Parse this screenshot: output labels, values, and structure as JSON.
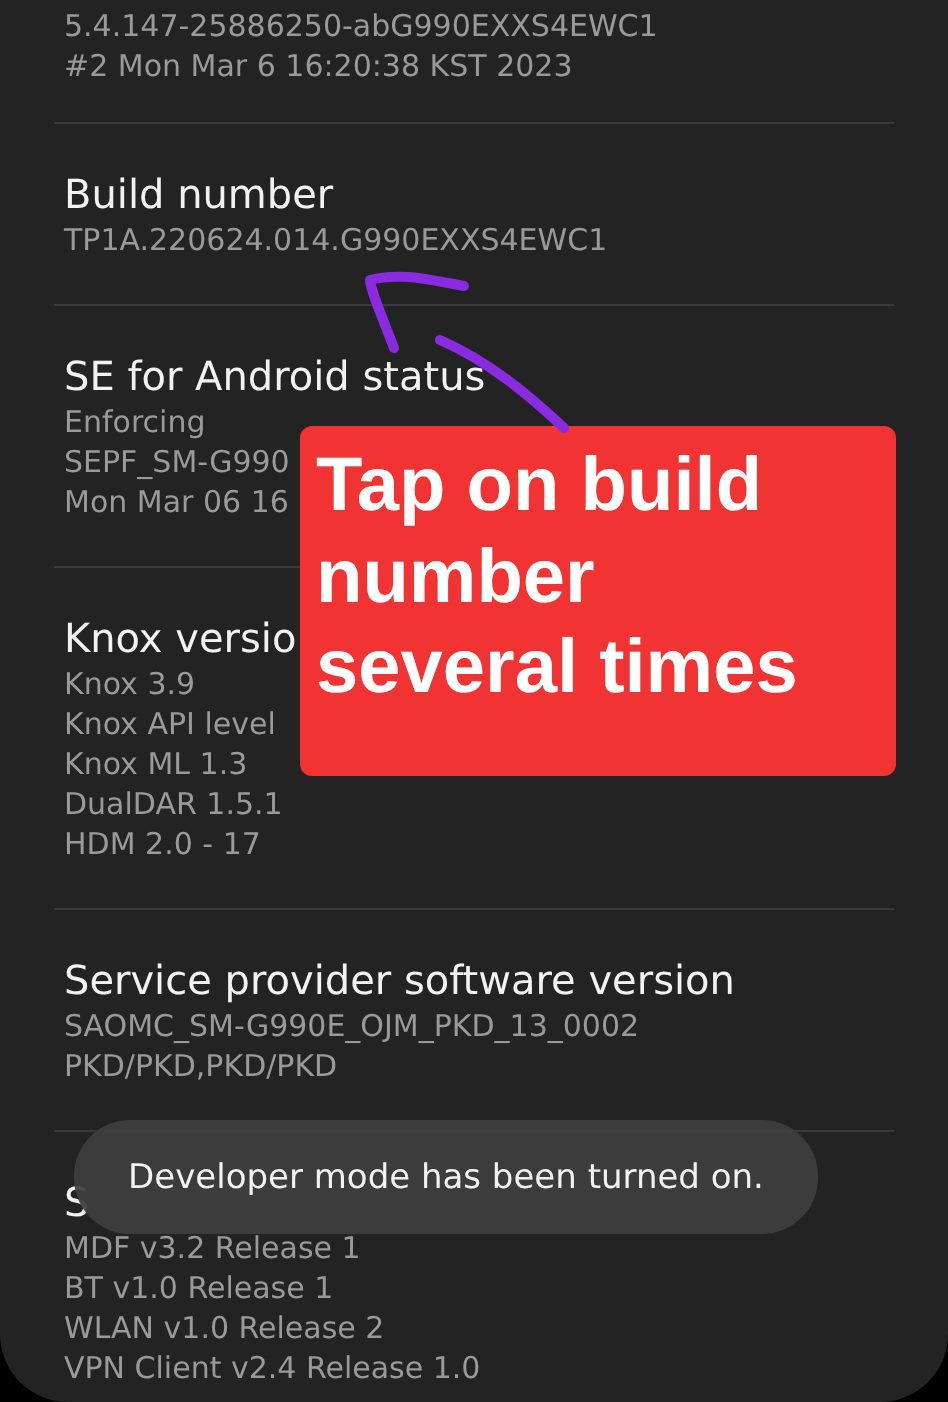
{
  "sections": [
    {
      "lines": [
        "5.4.147-25886250-abG990EXXS4EWC1",
        "#2 Mon Mar 6 16:20:38 KST 2023"
      ]
    },
    {
      "title": "Build number",
      "lines": [
        "TP1A.220624.014.G990EXXS4EWC1"
      ]
    },
    {
      "title": "SE for Android status",
      "lines": [
        "Enforcing",
        "SEPF_SM-G990",
        "Mon Mar 06 16"
      ]
    },
    {
      "title": "Knox versio",
      "lines": [
        "Knox 3.9",
        "Knox API level",
        "Knox ML 1.3",
        "DualDAR 1.5.1",
        "HDM 2.0 - 17"
      ]
    },
    {
      "title": "Service provider software version",
      "lines": [
        "SAOMC_SM-G990E_OJM_PKD_13_0002",
        "PKD/PKD,PKD/PKD"
      ]
    },
    {
      "title": "S",
      "lines": [
        "MDF v3.2 Release 1",
        "BT v1.0 Release 1",
        "WLAN v1.0 Release 2",
        "VPN Client v2.4 Release 1.0"
      ]
    }
  ],
  "annotation": {
    "text": "Tap on build number several times"
  },
  "toast": {
    "text": "Developer mode has been turned on."
  }
}
